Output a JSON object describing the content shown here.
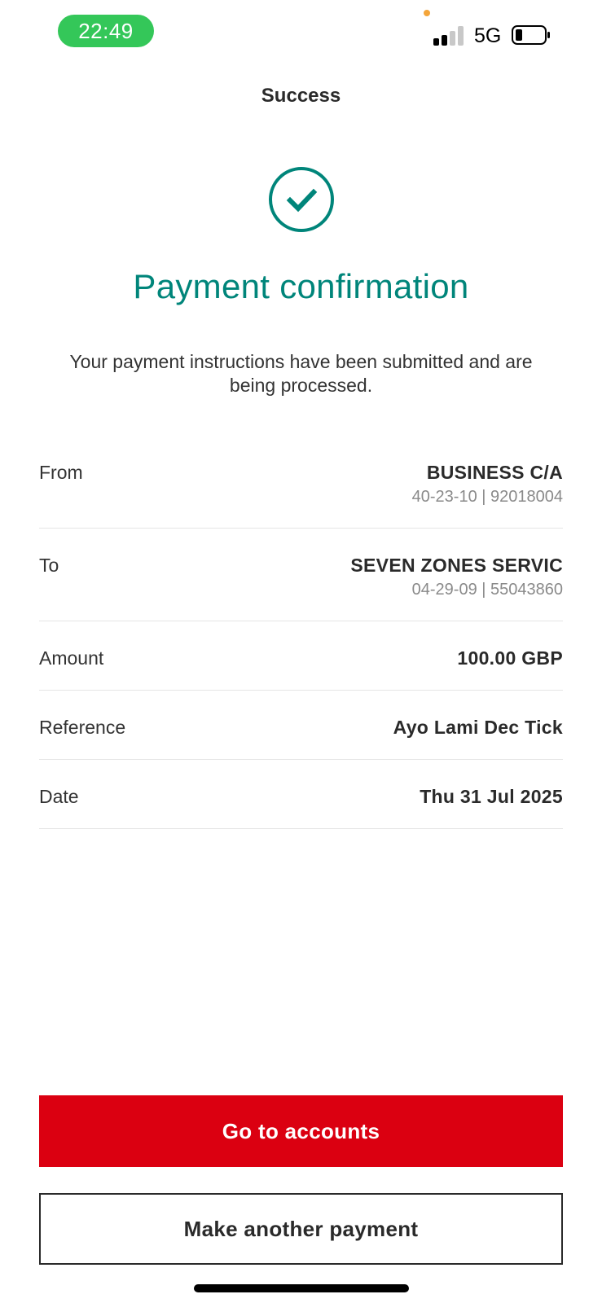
{
  "status_bar": {
    "time": "22:49",
    "network": "5G",
    "colors": {
      "time_pill": "#34c759",
      "privacy_dot": "#f4a53a"
    },
    "signal_bars_active": 2,
    "signal_bars_total": 4,
    "battery_level": 0.2
  },
  "header": {
    "title": "Success"
  },
  "confirmation": {
    "icon": "check-circle-icon",
    "title": "Payment confirmation",
    "message": "Your payment instructions have been submitted and are being processed.",
    "accent_color": "#00857a"
  },
  "details": {
    "from": {
      "label": "From",
      "name": "BUSINESS C/A",
      "account": "40-23-10 | 92018004"
    },
    "to": {
      "label": "To",
      "name": "SEVEN ZONES SERVIC",
      "account": "04-29-09 | 55043860"
    },
    "amount": {
      "label": "Amount",
      "value": "100.00 GBP"
    },
    "reference": {
      "label": "Reference",
      "value": "Ayo Lami Dec Tick"
    },
    "date": {
      "label": "Date",
      "value": "Thu 31 Jul 2025"
    }
  },
  "actions": {
    "primary_label": "Go to accounts",
    "secondary_label": "Make another payment",
    "primary_color": "#db0011"
  }
}
